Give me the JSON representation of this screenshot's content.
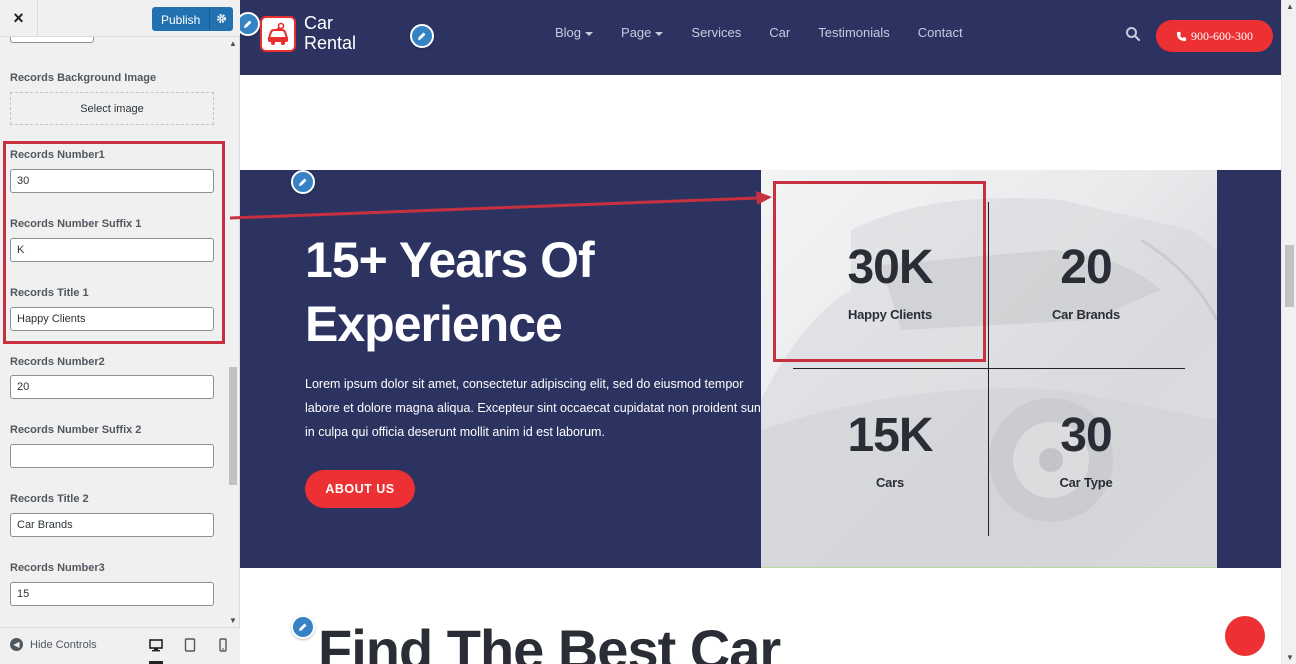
{
  "customizer": {
    "close_label": "×",
    "publish_label": "Publish",
    "fields": {
      "bg_image_label": "Records Background Image",
      "select_image_label": "Select image",
      "number1_label": "Records Number1",
      "number1_value": "30",
      "suffix1_label": "Records Number Suffix 1",
      "suffix1_value": "K",
      "title1_label": "Records Title 1",
      "title1_value": "Happy Clients",
      "number2_label": "Records Number2",
      "number2_value": "20",
      "suffix2_label": "Records Number Suffix 2",
      "suffix2_value": "",
      "title2_label": "Records Title 2",
      "title2_value": "Car Brands",
      "number3_label": "Records Number3",
      "number3_value": "15"
    },
    "footer": {
      "hide_controls_label": "Hide Controls"
    }
  },
  "site": {
    "logo_line1": "Car",
    "logo_line2": "Rental",
    "nav": [
      "Blog",
      "Page",
      "Services",
      "Car",
      "Testimonials",
      "Contact"
    ],
    "phone_label": "900-600-300",
    "stats_section": {
      "heading_line1": "15+ Years Of",
      "heading_line2": "Experience",
      "description": "Lorem ipsum dolor sit amet, consectetur adipiscing elit, sed do eiusmod tempor labore et dolore magna aliqua. Excepteur sint occaecat cupidatat non proident sunt in culpa qui officia deserunt mollit anim id est laborum.",
      "button_label": "ABOUT US",
      "stats": [
        {
          "number": "30",
          "suffix": "K",
          "title": "Happy Clients"
        },
        {
          "number": "20",
          "suffix": "",
          "title": "Car Brands"
        },
        {
          "number": "15",
          "suffix": "K",
          "title": "Cars"
        },
        {
          "number": "30",
          "suffix": "",
          "title": "Car Type"
        }
      ]
    },
    "next_heading": "Find The Best Car"
  },
  "colors": {
    "header_bg": "#2d3361",
    "accent_red": "#ec3033",
    "wp_blue": "#2271b1",
    "highlight_red": "#c7303f"
  }
}
